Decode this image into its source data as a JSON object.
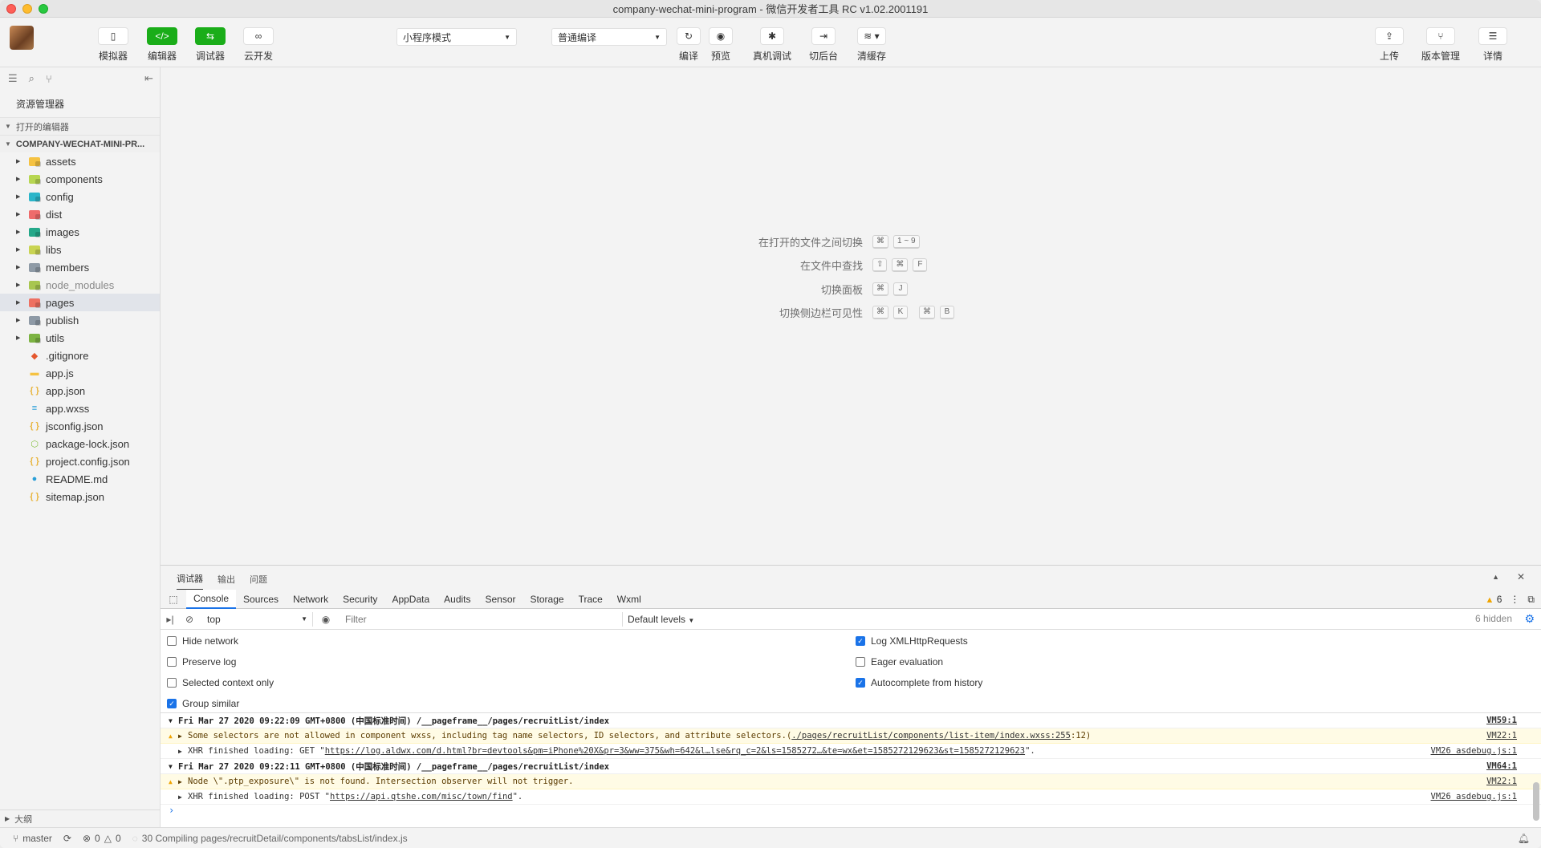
{
  "window": {
    "title": "company-wechat-mini-program - 微信开发者工具 RC v1.02.2001191"
  },
  "toolbar": {
    "simulator": "模拟器",
    "editor": "编辑器",
    "debugger": "调试器",
    "cloud": "云开发",
    "mode_select": "小程序模式",
    "compile_select": "普通编译",
    "compile": "编译",
    "preview": "预览",
    "remote_debug": "真机调试",
    "background": "切后台",
    "clear_cache": "清缓存",
    "upload": "上传",
    "version": "版本管理",
    "details": "详情"
  },
  "sidebar": {
    "header": "资源管理器",
    "open_editors": "打开的编辑器",
    "project": "COMPANY-WECHAT-MINI-PR...",
    "outline": "大纲",
    "items": [
      {
        "name": "assets",
        "type": "folder",
        "color": "#f5c242"
      },
      {
        "name": "components",
        "type": "folder",
        "color": "#b7d651"
      },
      {
        "name": "config",
        "type": "folder",
        "color": "#2bb5c9"
      },
      {
        "name": "dist",
        "type": "folder",
        "color": "#ee6b6b"
      },
      {
        "name": "images",
        "type": "folder",
        "color": "#24a889"
      },
      {
        "name": "libs",
        "type": "folder",
        "color": "#c9d452"
      },
      {
        "name": "members",
        "type": "folder",
        "color": "#8e9aa6"
      },
      {
        "name": "node_modules",
        "type": "folder",
        "color": "#a8c64f"
      },
      {
        "name": "pages",
        "type": "folder",
        "color": "#ee7062"
      },
      {
        "name": "publish",
        "type": "folder",
        "color": "#8e9aa6"
      },
      {
        "name": "utils",
        "type": "folder",
        "color": "#7cb342"
      },
      {
        "name": ".gitignore",
        "type": "file",
        "icon": "◆",
        "color": "#e4572e"
      },
      {
        "name": "app.js",
        "type": "file",
        "icon": "▬",
        "color": "#f5c242"
      },
      {
        "name": "app.json",
        "type": "file",
        "icon": "{ }",
        "color": "#e8b53f"
      },
      {
        "name": "app.wxss",
        "type": "file",
        "icon": "≡",
        "color": "#2a9fd8"
      },
      {
        "name": "jsconfig.json",
        "type": "file",
        "icon": "{ }",
        "color": "#e8b53f"
      },
      {
        "name": "package-lock.json",
        "type": "file",
        "icon": "⬡",
        "color": "#8bc34a"
      },
      {
        "name": "project.config.json",
        "type": "file",
        "icon": "{ }",
        "color": "#e8b53f"
      },
      {
        "name": "README.md",
        "type": "file",
        "icon": "●",
        "color": "#2a9fd8"
      },
      {
        "name": "sitemap.json",
        "type": "file",
        "icon": "{ }",
        "color": "#e8b53f"
      }
    ]
  },
  "editor_hints": [
    {
      "text": "在打开的文件之间切换",
      "keys": [
        "⌘",
        "1 ~ 9"
      ]
    },
    {
      "text": "在文件中查找",
      "keys": [
        "⇧",
        "⌘",
        "F"
      ]
    },
    {
      "text": "切换面板",
      "keys": [
        "⌘",
        "J"
      ]
    },
    {
      "text": "切换侧边栏可见性",
      "keys": [
        "⌘",
        "K",
        "⌘",
        "B"
      ]
    }
  ],
  "devtools": {
    "top_tabs": [
      "调试器",
      "输出",
      "问题"
    ],
    "tabs": [
      "Console",
      "Sources",
      "Network",
      "Security",
      "AppData",
      "Audits",
      "Sensor",
      "Storage",
      "Trace",
      "Wxml"
    ],
    "warning_count": "6",
    "context": "top",
    "filter_placeholder": "Filter",
    "levels": "Default levels",
    "hidden": "6 hidden",
    "settings_left": [
      {
        "label": "Hide network",
        "checked": false
      },
      {
        "label": "Preserve log",
        "checked": false
      },
      {
        "label": "Selected context only",
        "checked": false
      },
      {
        "label": "Group similar",
        "checked": true
      }
    ],
    "settings_right": [
      {
        "label": "Log XMLHttpRequests",
        "checked": true
      },
      {
        "label": "Eager evaluation",
        "checked": false
      },
      {
        "label": "Autocomplete from history",
        "checked": true
      }
    ],
    "logs": {
      "g1": "Fri Mar 27 2020 09:22:09 GMT+0800 (中国标准时间) /__pageframe__/pages/recruitList/index",
      "g1_src": "VM59:1",
      "w1_pre": "Some selectors are not allowed in component wxss, including tag name selectors, ID selectors, and attribute selectors.(",
      "w1_link": "./pages/recruitList/components/list-item/index.wxss:255",
      "w1_post": ":12)",
      "w1_src": "VM22:1",
      "x1_pre": "XHR finished loading: GET \"",
      "x1_link": "https://log.aldwx.com/d.html?br=devtools&pm=iPhone%20X&pr=3&ww=375&wh=642&l…lse&rq_c=2&ls=1585272…&te=wx&et=1585272129623&st=1585272129623",
      "x1_post": "\".",
      "x1_src": "VM26 asdebug.js:1",
      "g2": "Fri Mar 27 2020 09:22:11 GMT+0800 (中国标准时间) /__pageframe__/pages/recruitList/index",
      "g2_src": "VM64:1",
      "w2": "Node \\\".ptp_exposure\\\" is not found. Intersection observer will not trigger.",
      "w2_src": "VM22:1",
      "x2_pre": "XHR finished loading: POST \"",
      "x2_link": "https://api.qtshe.com/misc/town/find",
      "x2_post": "\".",
      "x2_src": "VM26 asdebug.js:1"
    }
  },
  "statusbar": {
    "branch": "master",
    "errors": "0",
    "warnings": "0",
    "task": "30 Compiling pages/recruitDetail/components/tabsList/index.js"
  }
}
